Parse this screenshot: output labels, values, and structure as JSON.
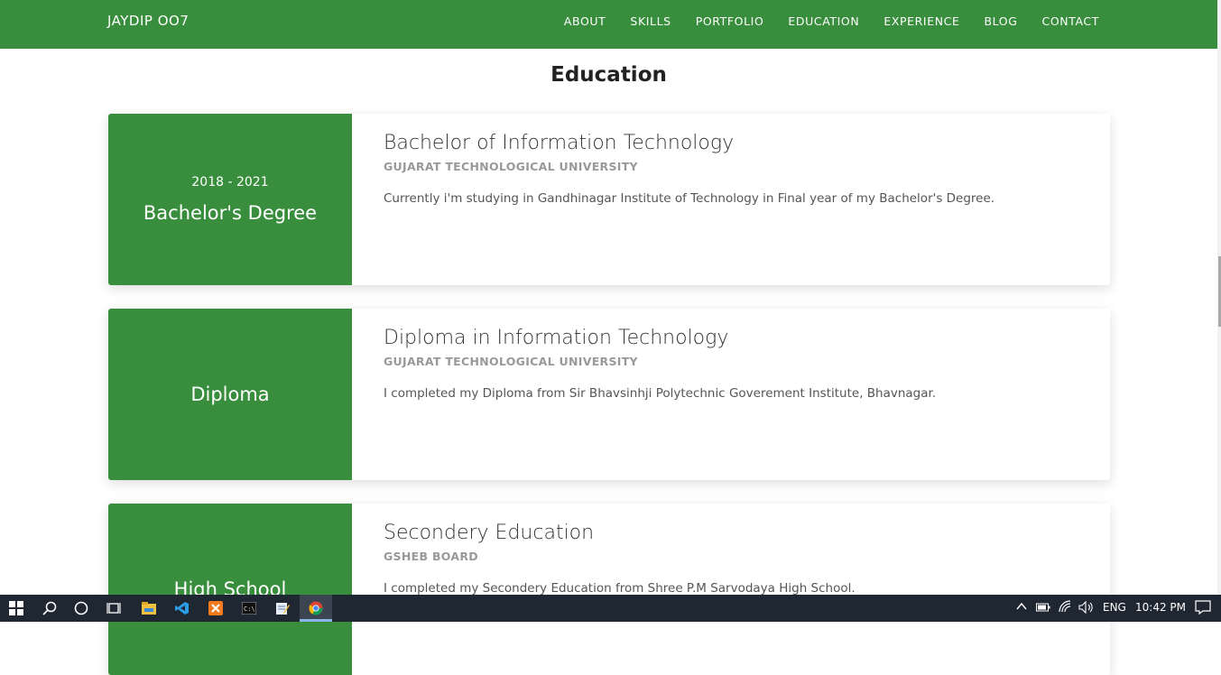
{
  "nav": {
    "brand": "JAYDIP OO7",
    "links": [
      "ABOUT",
      "SKILLS",
      "PORTFOLIO",
      "EDUCATION",
      "EXPERIENCE",
      "BLOG",
      "CONTACT"
    ]
  },
  "section": {
    "title": "Education"
  },
  "education": [
    {
      "years": "2018 - 2021",
      "level": "Bachelor's Degree",
      "title": "Bachelor of Information Technology",
      "institution": "GUJARAT TECHNOLOGICAL UNIVERSITY",
      "description": "Currently i'm studying in Gandhinagar Institute of Technology in Final year of my Bachelor's Degree."
    },
    {
      "years": "",
      "level": "Diploma",
      "title": "Diploma in Information Technology",
      "institution": "GUJARAT TECHNOLOGICAL UNIVERSITY",
      "description": "I completed my Diploma from Sir Bhavsinhji Polytechnic Goverement Institute, Bhavnagar."
    },
    {
      "years": "",
      "level": "High School",
      "title": "Secondery Education",
      "institution": "GSHEB BOARD",
      "description": "I completed my Secondery Education from Shree P.M Sarvodaya High School."
    }
  ],
  "taskbar": {
    "language": "ENG",
    "time": "10:42 PM"
  },
  "colors": {
    "accent": "#388e3c",
    "taskbar": "#1f2733"
  }
}
